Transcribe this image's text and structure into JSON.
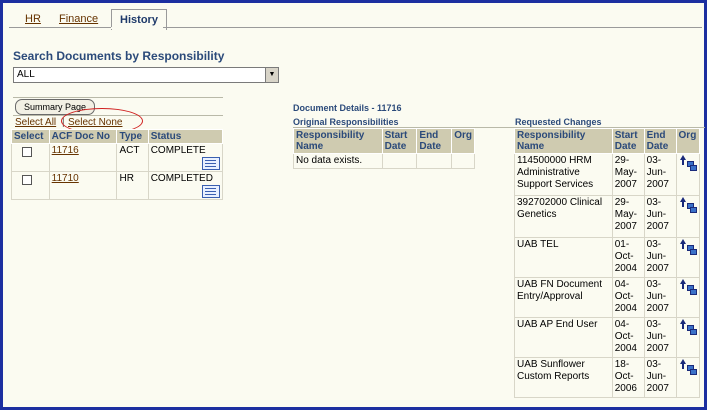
{
  "tabs": [
    {
      "label": "HR",
      "active": false
    },
    {
      "label": "Finance",
      "active": false
    },
    {
      "label": "History",
      "active": true
    }
  ],
  "search": {
    "title": "Search Documents by Responsibility",
    "select_value": "ALL"
  },
  "actions": {
    "summary_button": "Summary Page",
    "select_all": "Select All",
    "separator": "|",
    "select_none": "Select None"
  },
  "doc_table": {
    "headers": [
      "Select",
      "ACF Doc No",
      "Type",
      "Status"
    ],
    "rows": [
      {
        "doc_no": "11716",
        "type": "ACT",
        "status": "COMPLETE"
      },
      {
        "doc_no": "11710",
        "type": "HR",
        "status": "COMPLETED"
      }
    ]
  },
  "details": {
    "title": "Document Details - 11716",
    "original": {
      "title": "Original Responsibilities",
      "headers": [
        "Responsibility Name",
        "Start Date",
        "End Date",
        "Org"
      ],
      "empty_text": "No data exists."
    },
    "requested": {
      "title": "Requested Changes",
      "headers": [
        "Responsibility Name",
        "Start Date",
        "End Date",
        "Org"
      ],
      "rows": [
        {
          "name": "114500000 HRM Administrative Support Services",
          "start": "29-May-2007",
          "end": "03-Jun-2007"
        },
        {
          "name": "392702000 Clinical Genetics",
          "start": "29-May-2007",
          "end": "03-Jun-2007"
        },
        {
          "name": "UAB TEL",
          "start": "01-Oct-2004",
          "end": "03-Jun-2007"
        },
        {
          "name": "UAB FN Document Entry/Approval",
          "start": "04-Oct-2004",
          "end": "03-Jun-2007"
        },
        {
          "name": "UAB AP End User",
          "start": "04-Oct-2004",
          "end": "03-Jun-2007"
        },
        {
          "name": "UAB Sunflower Custom Reports",
          "start": "18-Oct-2006",
          "end": "03-Jun-2007"
        }
      ]
    }
  },
  "colors": {
    "frame": "#1c2fa0",
    "header_bg": "#cfcbb0",
    "header_text": "#2b4a7a",
    "link": "#663300",
    "annotation_circle": "#d02020"
  }
}
